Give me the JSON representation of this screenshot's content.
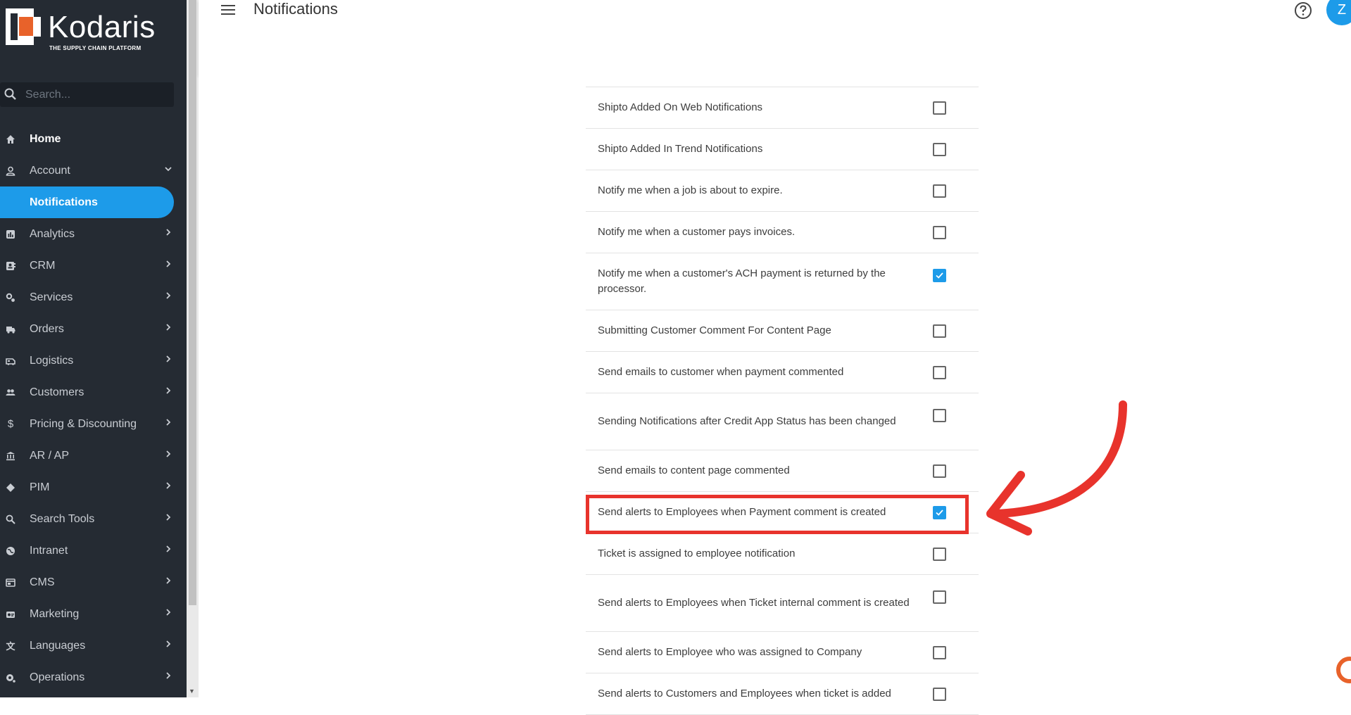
{
  "brand": {
    "name": "Kodaris",
    "tagline": "THE SUPPLY CHAIN PLATFORM"
  },
  "search": {
    "placeholder": "Search..."
  },
  "sidebar": {
    "items": [
      {
        "label": "Home",
        "icon": "home-icon"
      },
      {
        "label": "Account",
        "icon": "person-icon"
      },
      {
        "label": "Notifications",
        "icon": ""
      },
      {
        "label": "Analytics",
        "icon": "analytics-icon"
      },
      {
        "label": "CRM",
        "icon": "crm-icon"
      },
      {
        "label": "Services",
        "icon": "services-icon"
      },
      {
        "label": "Orders",
        "icon": "truck-icon"
      },
      {
        "label": "Logistics",
        "icon": "logistics-icon"
      },
      {
        "label": "Customers",
        "icon": "people-icon"
      },
      {
        "label": "Pricing & Discounting",
        "icon": "dollar-icon"
      },
      {
        "label": "AR / AP",
        "icon": "bank-icon"
      },
      {
        "label": "PIM",
        "icon": "tag-icon"
      },
      {
        "label": "Search Tools",
        "icon": "search-icon"
      },
      {
        "label": "Intranet",
        "icon": "globe-icon"
      },
      {
        "label": "CMS",
        "icon": "cms-icon"
      },
      {
        "label": "Marketing",
        "icon": "marketing-icon"
      },
      {
        "label": "Languages",
        "icon": "translate-icon"
      },
      {
        "label": "Operations",
        "icon": "operations-icon"
      }
    ]
  },
  "header": {
    "title": "Notifications",
    "avatar_initial": "Z"
  },
  "notifications": [
    {
      "label": "Shipto Added On Web Notifications",
      "checked": false
    },
    {
      "label": "Shipto Added In Trend Notifications",
      "checked": false
    },
    {
      "label": "Notify me when a job is about to expire.",
      "checked": false
    },
    {
      "label": "Notify me when a customer pays invoices.",
      "checked": false
    },
    {
      "label": "Notify me when a customer's ACH payment is returned by the processor.",
      "checked": true
    },
    {
      "label": "Submitting Customer Comment For Content Page",
      "checked": false
    },
    {
      "label": "Send emails to customer when payment commented",
      "checked": false
    },
    {
      "label": "Sending Notifications after Credit App Status has been changed",
      "checked": false
    },
    {
      "label": "Send emails to content page commented",
      "checked": false
    },
    {
      "label": "Send alerts to Employees when Payment comment is created",
      "checked": true
    },
    {
      "label": "Ticket is assigned to employee notification",
      "checked": false
    },
    {
      "label": "Send alerts to Employees when Ticket internal comment is created",
      "checked": false
    },
    {
      "label": "Send alerts to Employee who was assigned to Company",
      "checked": false
    },
    {
      "label": "Send alerts to Customers and Employees when ticket is added",
      "checked": false
    }
  ],
  "colors": {
    "accent": "#1d9be9",
    "sidebar_bg": "#252b33",
    "annotation": "#e8332c",
    "logo_orange": "#e8622a"
  }
}
